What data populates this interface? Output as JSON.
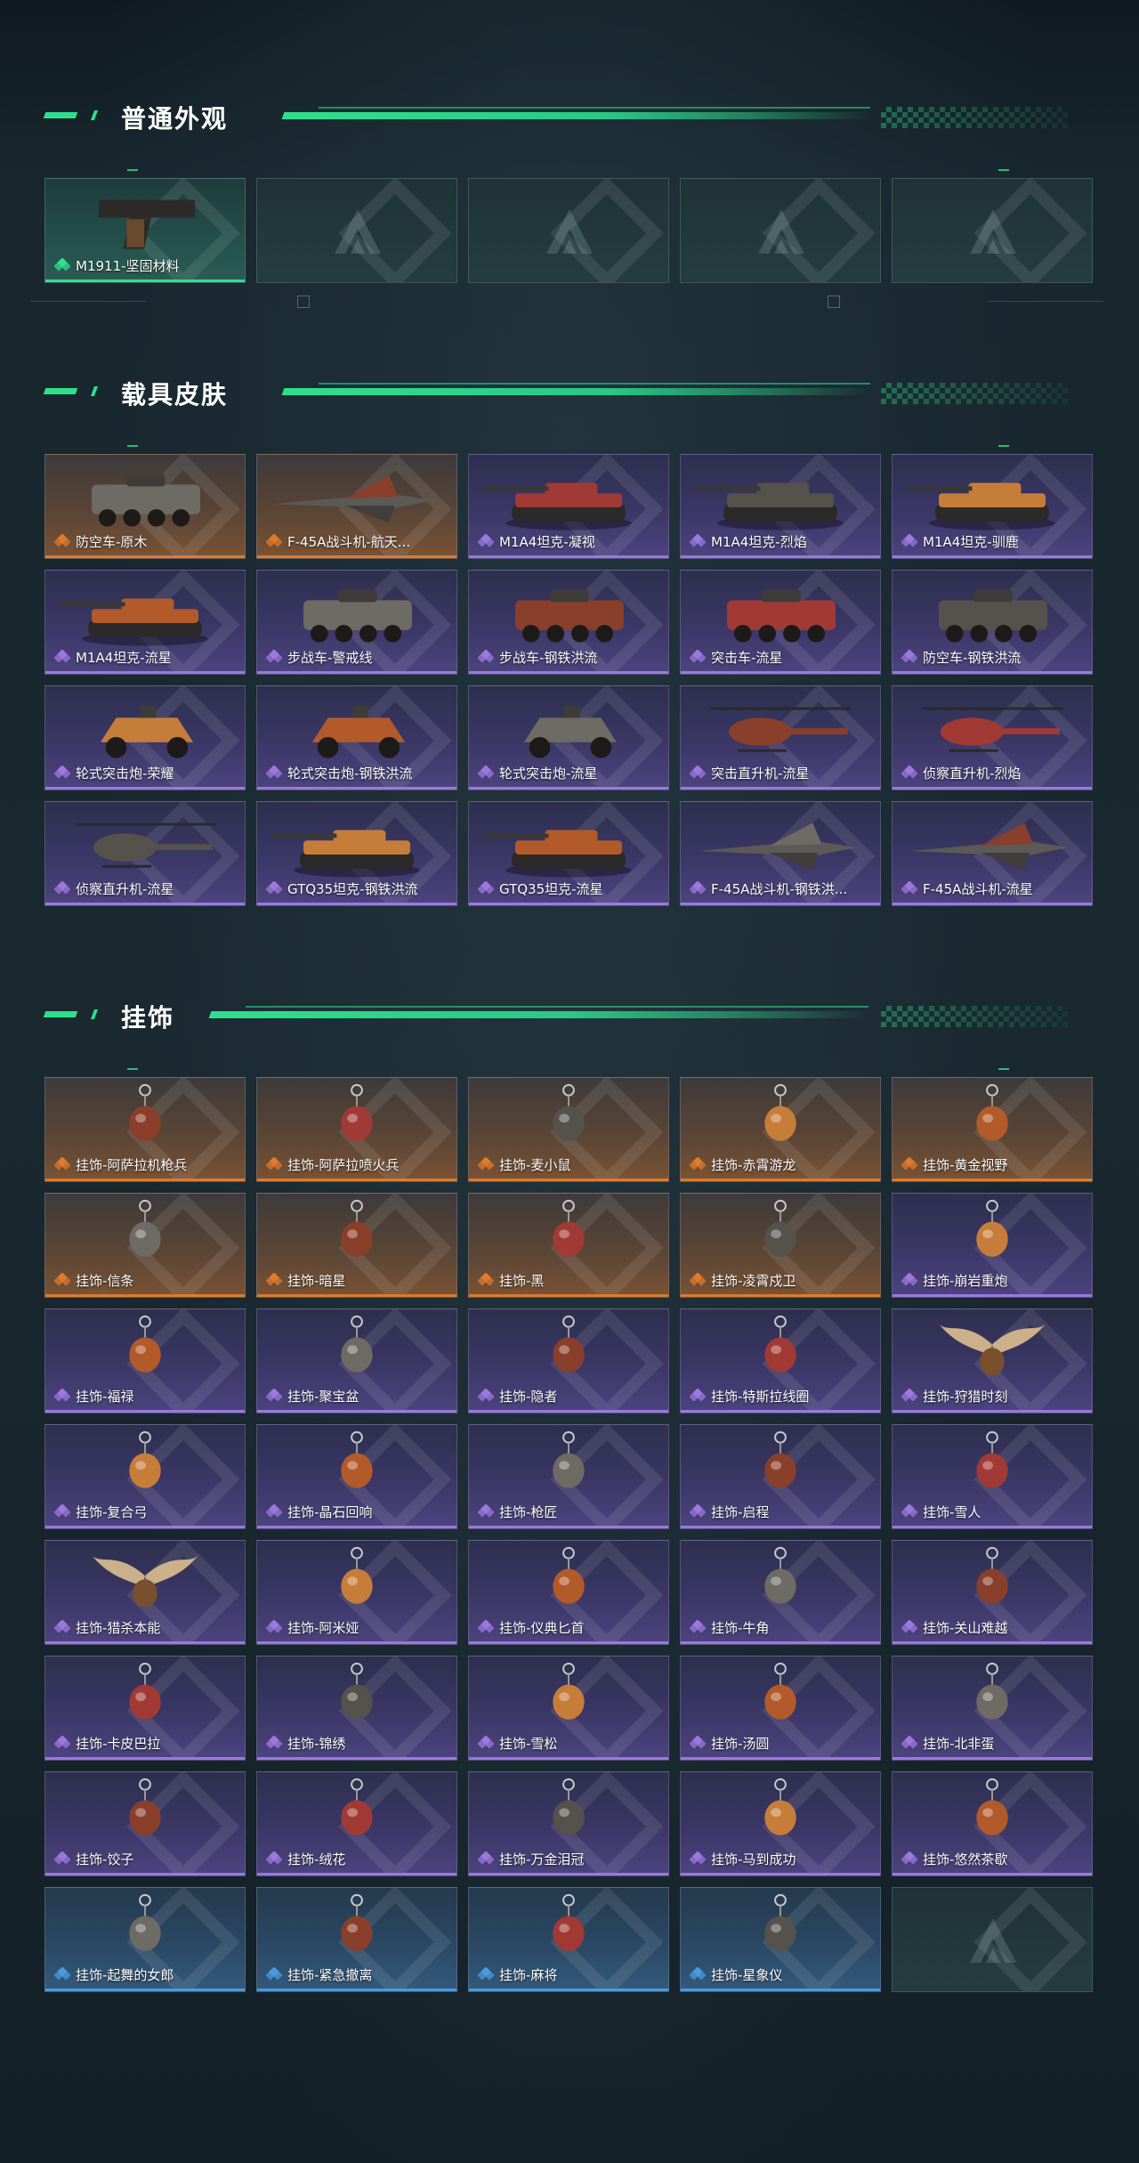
{
  "sections": [
    {
      "title": "普通外观",
      "items": [
        {
          "label": "M1911-坚固材料",
          "rarity": "green",
          "icon": "pistol-icon"
        },
        {
          "label": "",
          "rarity": "empty",
          "icon": "placeholder-logo-icon"
        },
        {
          "label": "",
          "rarity": "empty",
          "icon": "placeholder-logo-icon"
        },
        {
          "label": "",
          "rarity": "empty",
          "icon": "placeholder-logo-icon"
        },
        {
          "label": "",
          "rarity": "empty",
          "icon": "placeholder-logo-icon"
        }
      ]
    },
    {
      "title": "载具皮肤",
      "items": [
        {
          "label": "防空车-原木",
          "rarity": "orange",
          "icon": "wheeled-vehicle-icon"
        },
        {
          "label": "F-45A战斗机-航天...",
          "rarity": "orange",
          "icon": "jet-icon"
        },
        {
          "label": "M1A4坦克-凝视",
          "rarity": "purple",
          "icon": "tank-icon"
        },
        {
          "label": "M1A4坦克-烈焰",
          "rarity": "purple",
          "icon": "tank-icon"
        },
        {
          "label": "M1A4坦克-驯鹿",
          "rarity": "purple",
          "icon": "tank-icon"
        },
        {
          "label": "M1A4坦克-流星",
          "rarity": "purple",
          "icon": "tank-icon"
        },
        {
          "label": "步战车-警戒线",
          "rarity": "purple",
          "icon": "wheeled-vehicle-icon"
        },
        {
          "label": "步战车-钢铁洪流",
          "rarity": "purple",
          "icon": "wheeled-vehicle-icon"
        },
        {
          "label": "突击车-流星",
          "rarity": "purple",
          "icon": "wheeled-vehicle-icon"
        },
        {
          "label": "防空车-钢铁洪流",
          "rarity": "purple",
          "icon": "wheeled-vehicle-icon"
        },
        {
          "label": "轮式突击炮-荣耀",
          "rarity": "purple",
          "icon": "buggy-icon"
        },
        {
          "label": "轮式突击炮-钢铁洪流",
          "rarity": "purple",
          "icon": "buggy-icon"
        },
        {
          "label": "轮式突击炮-流星",
          "rarity": "purple",
          "icon": "buggy-icon"
        },
        {
          "label": "突击直升机-流星",
          "rarity": "purple",
          "icon": "helicopter-icon"
        },
        {
          "label": "侦察直升机-烈焰",
          "rarity": "purple",
          "icon": "helicopter-icon"
        },
        {
          "label": "侦察直升机-流星",
          "rarity": "purple",
          "icon": "helicopter-icon"
        },
        {
          "label": "GTQ35坦克-钢铁洪流",
          "rarity": "purple",
          "icon": "tank-icon"
        },
        {
          "label": "GTQ35坦克-流星",
          "rarity": "purple",
          "icon": "tank-icon"
        },
        {
          "label": "F-45A战斗机-钢铁洪...",
          "rarity": "purple",
          "icon": "jet-icon"
        },
        {
          "label": "F-45A战斗机-流星",
          "rarity": "purple",
          "icon": "jet-icon"
        }
      ]
    },
    {
      "title": "挂饰",
      "items": [
        {
          "label": "挂饰-阿萨拉机枪兵",
          "rarity": "orange",
          "icon": "charm-icon"
        },
        {
          "label": "挂饰-阿萨拉喷火兵",
          "rarity": "orange",
          "icon": "charm-icon"
        },
        {
          "label": "挂饰-麦小鼠",
          "rarity": "orange",
          "icon": "charm-icon"
        },
        {
          "label": "挂饰-赤霄游龙",
          "rarity": "orange",
          "icon": "charm-icon"
        },
        {
          "label": "挂饰-黄金视野",
          "rarity": "orange",
          "icon": "charm-icon"
        },
        {
          "label": "挂饰-信条",
          "rarity": "orange",
          "icon": "charm-icon"
        },
        {
          "label": "挂饰-暗星",
          "rarity": "orange",
          "icon": "charm-icon"
        },
        {
          "label": "挂饰-黑",
          "rarity": "orange",
          "icon": "charm-icon"
        },
        {
          "label": "挂饰-凌霄戍卫",
          "rarity": "orange",
          "icon": "charm-icon"
        },
        {
          "label": "挂饰-崩岩重炮",
          "rarity": "purple",
          "icon": "charm-icon"
        },
        {
          "label": "挂饰-福禄",
          "rarity": "purple",
          "icon": "charm-icon"
        },
        {
          "label": "挂饰-聚宝盆",
          "rarity": "purple",
          "icon": "charm-icon"
        },
        {
          "label": "挂饰-隐者",
          "rarity": "purple",
          "icon": "charm-icon"
        },
        {
          "label": "挂饰-特斯拉线圈",
          "rarity": "purple",
          "icon": "charm-icon"
        },
        {
          "label": "挂饰-狩猎时刻",
          "rarity": "purple",
          "icon": "antler-charm-icon"
        },
        {
          "label": "挂饰-复合弓",
          "rarity": "purple",
          "icon": "charm-icon"
        },
        {
          "label": "挂饰-晶石回响",
          "rarity": "purple",
          "icon": "charm-icon"
        },
        {
          "label": "挂饰-枪匠",
          "rarity": "purple",
          "icon": "charm-icon"
        },
        {
          "label": "挂饰-启程",
          "rarity": "purple",
          "icon": "charm-icon"
        },
        {
          "label": "挂饰-雪人",
          "rarity": "purple",
          "icon": "charm-icon"
        },
        {
          "label": "挂饰-猎杀本能",
          "rarity": "purple",
          "icon": "antler-charm-icon"
        },
        {
          "label": "挂饰-阿米娅",
          "rarity": "purple",
          "icon": "charm-icon"
        },
        {
          "label": "挂饰-仪典匕首",
          "rarity": "purple",
          "icon": "charm-icon"
        },
        {
          "label": "挂饰-牛角",
          "rarity": "purple",
          "icon": "charm-icon"
        },
        {
          "label": "挂饰-关山难越",
          "rarity": "purple",
          "icon": "charm-icon"
        },
        {
          "label": "挂饰-卡皮巴拉",
          "rarity": "purple",
          "icon": "charm-icon"
        },
        {
          "label": "挂饰-锦绣",
          "rarity": "purple",
          "icon": "charm-icon"
        },
        {
          "label": "挂饰-雪松",
          "rarity": "purple",
          "icon": "charm-icon"
        },
        {
          "label": "挂饰-汤圆",
          "rarity": "purple",
          "icon": "charm-icon"
        },
        {
          "label": "挂饰-北非蛋",
          "rarity": "purple",
          "icon": "charm-icon"
        },
        {
          "label": "挂饰-饺子",
          "rarity": "purple",
          "icon": "charm-icon"
        },
        {
          "label": "挂饰-绒花",
          "rarity": "purple",
          "icon": "charm-icon"
        },
        {
          "label": "挂饰-万金泪冠",
          "rarity": "purple",
          "icon": "charm-icon"
        },
        {
          "label": "挂饰-马到成功",
          "rarity": "purple",
          "icon": "charm-icon"
        },
        {
          "label": "挂饰-悠然茶歇",
          "rarity": "purple",
          "icon": "charm-icon"
        },
        {
          "label": "挂饰-起舞的女郎",
          "rarity": "blue",
          "icon": "charm-icon"
        },
        {
          "label": "挂饰-紧急撤离",
          "rarity": "blue",
          "icon": "charm-icon"
        },
        {
          "label": "挂饰-麻将",
          "rarity": "blue",
          "icon": "charm-icon"
        },
        {
          "label": "挂饰-星象仪",
          "rarity": "blue",
          "icon": "charm-icon"
        },
        {
          "label": "",
          "rarity": "empty",
          "icon": "placeholder-logo-icon"
        }
      ]
    }
  ],
  "colors": {
    "accent": "#2ee08d",
    "orange": "#e07a2c",
    "purple": "#9d78e0",
    "blue": "#4a9be0",
    "green": "#2ee08d"
  }
}
